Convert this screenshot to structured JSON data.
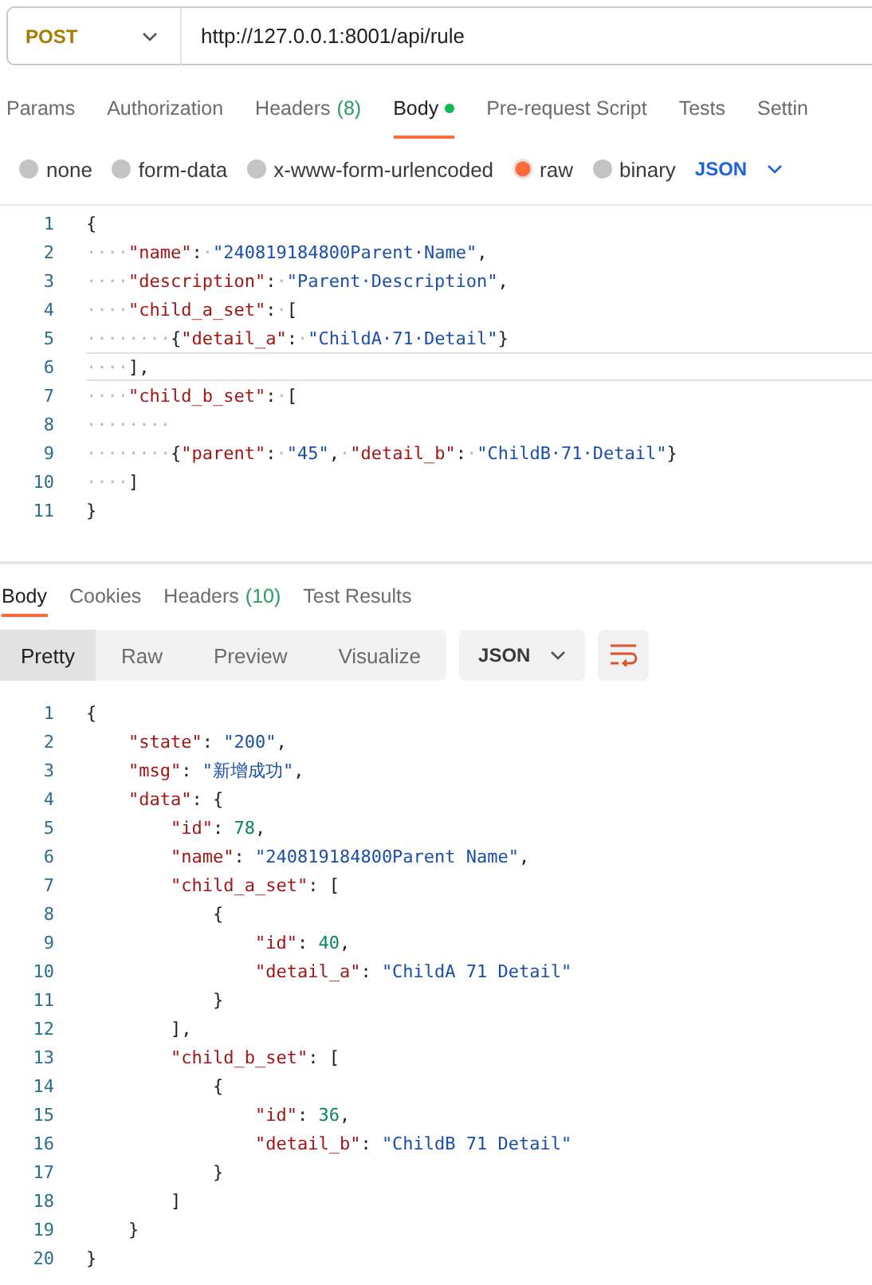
{
  "request": {
    "method": "POST",
    "url": "http://127.0.0.1:8001/api/rule"
  },
  "request_tabs": [
    {
      "label": "Params",
      "selected": false,
      "indicator": false
    },
    {
      "label": "Authorization",
      "selected": false,
      "indicator": false
    },
    {
      "label": "Headers",
      "count": "(8)",
      "selected": false,
      "indicator": false
    },
    {
      "label": "Body",
      "selected": true,
      "indicator": true
    },
    {
      "label": "Pre-request Script",
      "selected": false,
      "indicator": false
    },
    {
      "label": "Tests",
      "selected": false,
      "indicator": false
    },
    {
      "label": "Settin",
      "selected": false,
      "indicator": false
    }
  ],
  "body_types": [
    {
      "label": "none",
      "selected": false
    },
    {
      "label": "form-data",
      "selected": false
    },
    {
      "label": "x-www-form-urlencoded",
      "selected": false
    },
    {
      "label": "raw",
      "selected": true
    },
    {
      "label": "binary",
      "selected": false
    }
  ],
  "body_format": "JSON",
  "request_body": [
    {
      "n": "1",
      "current": false,
      "tokens": [
        {
          "kind": "punct",
          "text": "{"
        }
      ]
    },
    {
      "n": "2",
      "current": false,
      "tokens": [
        {
          "kind": "space",
          "text": "····"
        },
        {
          "kind": "key",
          "text": "\"name\""
        },
        {
          "kind": "punct",
          "text": ":"
        },
        {
          "kind": "space",
          "text": "·"
        },
        {
          "kind": "string",
          "text": "\"240819184800Parent·Name\""
        },
        {
          "kind": "punct",
          "text": ","
        }
      ]
    },
    {
      "n": "3",
      "current": false,
      "tokens": [
        {
          "kind": "space",
          "text": "····"
        },
        {
          "kind": "key",
          "text": "\"description\""
        },
        {
          "kind": "punct",
          "text": ":"
        },
        {
          "kind": "space",
          "text": "·"
        },
        {
          "kind": "string",
          "text": "\"Parent·Description\""
        },
        {
          "kind": "punct",
          "text": ","
        }
      ]
    },
    {
      "n": "4",
      "current": false,
      "tokens": [
        {
          "kind": "space",
          "text": "····"
        },
        {
          "kind": "key",
          "text": "\"child_a_set\""
        },
        {
          "kind": "punct",
          "text": ":"
        },
        {
          "kind": "space",
          "text": "·"
        },
        {
          "kind": "punct",
          "text": "["
        }
      ]
    },
    {
      "n": "5",
      "current": false,
      "tokens": [
        {
          "kind": "space",
          "text": "········"
        },
        {
          "kind": "punct",
          "text": "{"
        },
        {
          "kind": "key",
          "text": "\"detail_a\""
        },
        {
          "kind": "punct",
          "text": ":"
        },
        {
          "kind": "space",
          "text": "·"
        },
        {
          "kind": "string",
          "text": "\"ChildA·71·Detail\""
        },
        {
          "kind": "punct",
          "text": "}"
        }
      ]
    },
    {
      "n": "6",
      "current": true,
      "tokens": [
        {
          "kind": "space",
          "text": "····"
        },
        {
          "kind": "punct",
          "text": "],"
        }
      ]
    },
    {
      "n": "7",
      "current": false,
      "tokens": [
        {
          "kind": "space",
          "text": "····"
        },
        {
          "kind": "key",
          "text": "\"child_b_set\""
        },
        {
          "kind": "punct",
          "text": ":"
        },
        {
          "kind": "space",
          "text": "·"
        },
        {
          "kind": "punct",
          "text": "["
        }
      ]
    },
    {
      "n": "8",
      "current": false,
      "tokens": [
        {
          "kind": "space",
          "text": "········"
        }
      ]
    },
    {
      "n": "9",
      "current": false,
      "tokens": [
        {
          "kind": "space",
          "text": "········"
        },
        {
          "kind": "punct",
          "text": "{"
        },
        {
          "kind": "key",
          "text": "\"parent\""
        },
        {
          "kind": "punct",
          "text": ":"
        },
        {
          "kind": "space",
          "text": "·"
        },
        {
          "kind": "string",
          "text": "\"45\""
        },
        {
          "kind": "punct",
          "text": ","
        },
        {
          "kind": "space",
          "text": "·"
        },
        {
          "kind": "key",
          "text": "\"detail_b\""
        },
        {
          "kind": "punct",
          "text": ":"
        },
        {
          "kind": "space",
          "text": "·"
        },
        {
          "kind": "string",
          "text": "\"ChildB·71·Detail\""
        },
        {
          "kind": "punct",
          "text": "}"
        }
      ]
    },
    {
      "n": "10",
      "current": false,
      "tokens": [
        {
          "kind": "space",
          "text": "····"
        },
        {
          "kind": "punct",
          "text": "]"
        }
      ]
    },
    {
      "n": "11",
      "current": false,
      "tokens": [
        {
          "kind": "punct",
          "text": "}"
        }
      ]
    }
  ],
  "response_tabs": [
    {
      "label": "Body",
      "selected": true
    },
    {
      "label": "Cookies",
      "selected": false
    },
    {
      "label": "Headers",
      "count": "(10)",
      "selected": false
    },
    {
      "label": "Test Results",
      "selected": false
    }
  ],
  "view_modes": [
    {
      "label": "Pretty",
      "selected": true
    },
    {
      "label": "Raw",
      "selected": false
    },
    {
      "label": "Preview",
      "selected": false
    },
    {
      "label": "Visualize",
      "selected": false
    }
  ],
  "response_format": "JSON",
  "response_body": [
    {
      "n": "1",
      "tokens": [
        {
          "kind": "punct",
          "text": "{"
        }
      ]
    },
    {
      "n": "2",
      "tokens": [
        {
          "kind": "key",
          "text": "    \"state\""
        },
        {
          "kind": "punct",
          "text": ": "
        },
        {
          "kind": "string",
          "text": "\"200\""
        },
        {
          "kind": "punct",
          "text": ","
        }
      ]
    },
    {
      "n": "3",
      "tokens": [
        {
          "kind": "key",
          "text": "    \"msg\""
        },
        {
          "kind": "punct",
          "text": ": "
        },
        {
          "kind": "string",
          "text": "\"新增成功\""
        },
        {
          "kind": "punct",
          "text": ","
        }
      ]
    },
    {
      "n": "4",
      "tokens": [
        {
          "kind": "key",
          "text": "    \"data\""
        },
        {
          "kind": "punct",
          "text": ": {"
        }
      ]
    },
    {
      "n": "5",
      "tokens": [
        {
          "kind": "key",
          "text": "        \"id\""
        },
        {
          "kind": "punct",
          "text": ": "
        },
        {
          "kind": "number",
          "text": "78"
        },
        {
          "kind": "punct",
          "text": ","
        }
      ]
    },
    {
      "n": "6",
      "tokens": [
        {
          "kind": "key",
          "text": "        \"name\""
        },
        {
          "kind": "punct",
          "text": ": "
        },
        {
          "kind": "string",
          "text": "\"240819184800Parent Name\""
        },
        {
          "kind": "punct",
          "text": ","
        }
      ]
    },
    {
      "n": "7",
      "tokens": [
        {
          "kind": "key",
          "text": "        \"child_a_set\""
        },
        {
          "kind": "punct",
          "text": ": ["
        }
      ]
    },
    {
      "n": "8",
      "tokens": [
        {
          "kind": "punct",
          "text": "            {"
        }
      ]
    },
    {
      "n": "9",
      "tokens": [
        {
          "kind": "key",
          "text": "                \"id\""
        },
        {
          "kind": "punct",
          "text": ": "
        },
        {
          "kind": "number",
          "text": "40"
        },
        {
          "kind": "punct",
          "text": ","
        }
      ]
    },
    {
      "n": "10",
      "tokens": [
        {
          "kind": "key",
          "text": "                \"detail_a\""
        },
        {
          "kind": "punct",
          "text": ": "
        },
        {
          "kind": "string",
          "text": "\"ChildA 71 Detail\""
        }
      ]
    },
    {
      "n": "11",
      "tokens": [
        {
          "kind": "punct",
          "text": "            }"
        }
      ]
    },
    {
      "n": "12",
      "tokens": [
        {
          "kind": "punct",
          "text": "        ],"
        }
      ]
    },
    {
      "n": "13",
      "tokens": [
        {
          "kind": "key",
          "text": "        \"child_b_set\""
        },
        {
          "kind": "punct",
          "text": ": ["
        }
      ]
    },
    {
      "n": "14",
      "tokens": [
        {
          "kind": "punct",
          "text": "            {"
        }
      ]
    },
    {
      "n": "15",
      "tokens": [
        {
          "kind": "key",
          "text": "                \"id\""
        },
        {
          "kind": "punct",
          "text": ": "
        },
        {
          "kind": "number",
          "text": "36"
        },
        {
          "kind": "punct",
          "text": ","
        }
      ]
    },
    {
      "n": "16",
      "tokens": [
        {
          "kind": "key",
          "text": "                \"detail_b\""
        },
        {
          "kind": "punct",
          "text": ": "
        },
        {
          "kind": "string",
          "text": "\"ChildB 71 Detail\""
        }
      ]
    },
    {
      "n": "17",
      "tokens": [
        {
          "kind": "punct",
          "text": "            }"
        }
      ]
    },
    {
      "n": "18",
      "tokens": [
        {
          "kind": "punct",
          "text": "        ]"
        }
      ]
    },
    {
      "n": "19",
      "tokens": [
        {
          "kind": "punct",
          "text": "    }"
        }
      ]
    },
    {
      "n": "20",
      "tokens": [
        {
          "kind": "punct",
          "text": "}"
        }
      ]
    }
  ]
}
